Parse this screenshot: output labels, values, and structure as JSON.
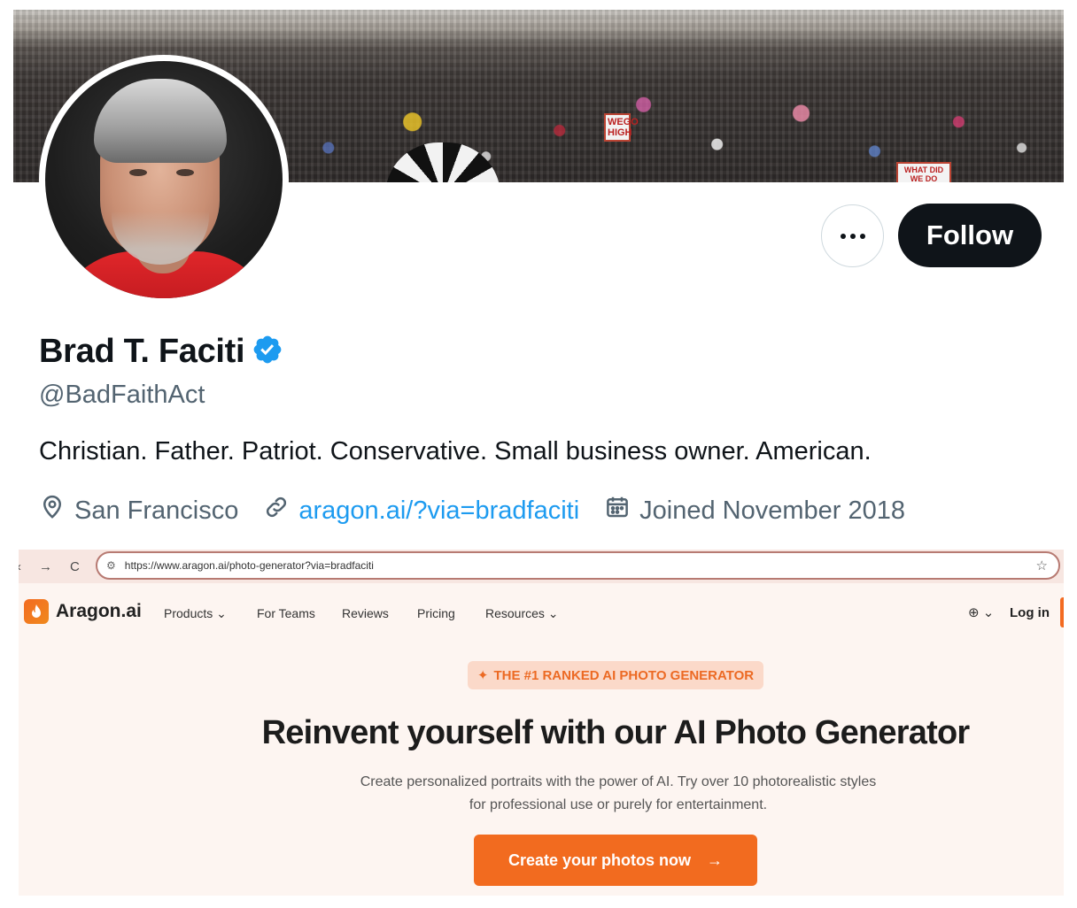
{
  "profile": {
    "name": "Brad T. Faciti",
    "handle": "@BadFaithAct",
    "bio": "Christian. Father. Patriot. Conservative. Small business owner. American.",
    "location": "San Francisco",
    "website": "aragon.ai/?via=bradfaciti",
    "joined": "Joined November 2018",
    "verified": true,
    "colors": {
      "verified_badge": "#1d9bf0",
      "link": "#1d9bf0",
      "follow_bg": "#0f1419"
    }
  },
  "actions": {
    "more_label": "•••",
    "follow_label": "Follow"
  },
  "banner": {
    "signs": [
      "WEGO HIGH",
      "WHAT DID WE DO WRONG"
    ]
  },
  "embedded_page": {
    "browser": {
      "back": "‹",
      "forward": "→",
      "reload": "C",
      "url": "https://www.aragon.ai/photo-generator?via=bradfaciti"
    },
    "nav": {
      "brand": "Aragon.ai",
      "items": [
        "Products ⌄",
        "For Teams",
        "Reviews",
        "Pricing",
        "Resources ⌄"
      ],
      "language": "⊕ ⌄",
      "login": "Log in"
    },
    "pill": "THE #1 RANKED AI PHOTO GENERATOR",
    "headline": "Reinvent yourself with our AI Photo Generator",
    "subtext_line1": "Create personalized portraits with the power of AI. Try over 10 photorealistic styles",
    "subtext_line2": "for professional use or purely for entertainment.",
    "cta_label": "Create your photos now",
    "colors": {
      "brand_orange": "#f26b1f",
      "pill_bg": "#fbd9c9",
      "page_bg": "#fdf5f1"
    }
  }
}
